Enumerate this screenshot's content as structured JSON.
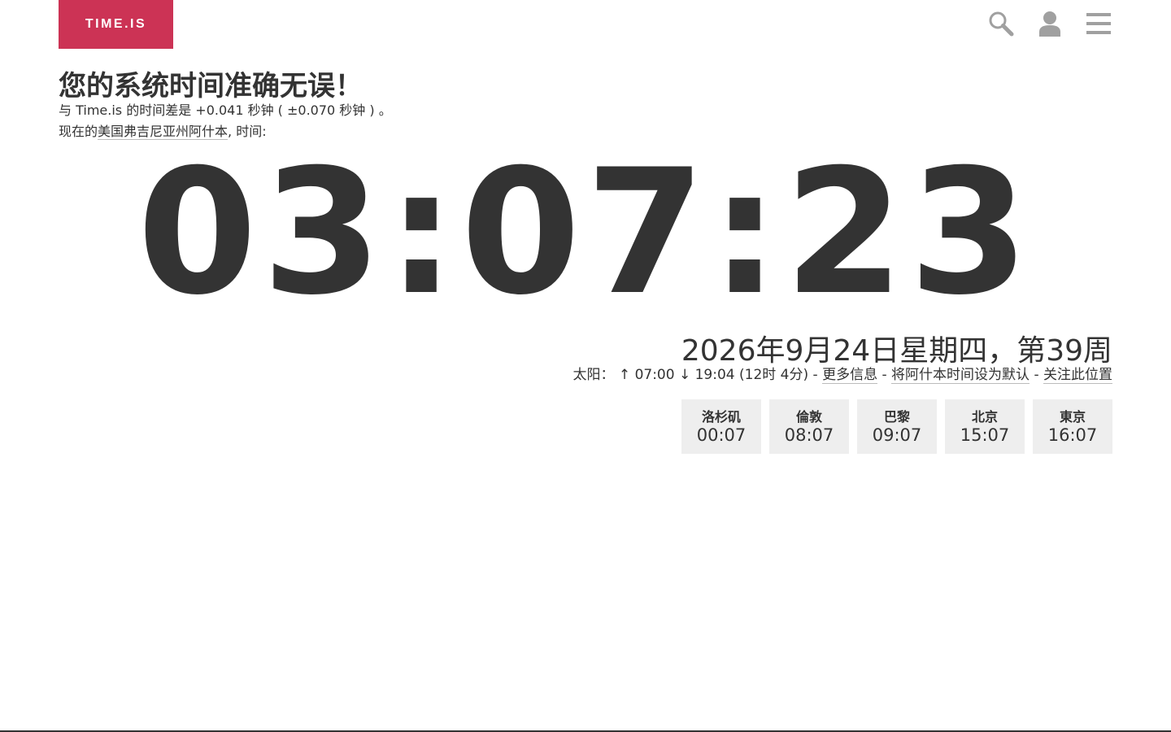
{
  "colors": {
    "brand": "#cc3355",
    "text": "#333333",
    "icon": "#a0a0a0",
    "city_bg": "#eeeeee"
  },
  "header": {
    "logo_text": "TIME.IS",
    "icons": [
      "search-icon",
      "user-icon",
      "menu-icon"
    ]
  },
  "status": {
    "headline": "您的系统时间准确无误！",
    "offset_line": "与 Time.is 的时间差是 +0.041 秒钟 ( ±0.070 秒钟 ) 。",
    "location_prefix": "现在的",
    "location_link": "美国弗吉尼亚州阿什本",
    "location_suffix": ", 时间:"
  },
  "clock": {
    "time": "03:07:23"
  },
  "date": {
    "text": "2026年9月24日星期四，第39周"
  },
  "sun": {
    "label": "太阳：",
    "sunrise": "↑ 07:00",
    "sunset": "↓ 19:04",
    "daylength": "(12时 4分)",
    "sep": " - ",
    "more_info": "更多信息",
    "set_default": "将阿什本时间设为默认",
    "watch_location": "关注此位置"
  },
  "cities": [
    {
      "name": "洛杉矶",
      "time": "00:07"
    },
    {
      "name": "倫敦",
      "time": "08:07"
    },
    {
      "name": "巴黎",
      "time": "09:07"
    },
    {
      "name": "北京",
      "time": "15:07"
    },
    {
      "name": "東京",
      "time": "16:07"
    }
  ]
}
